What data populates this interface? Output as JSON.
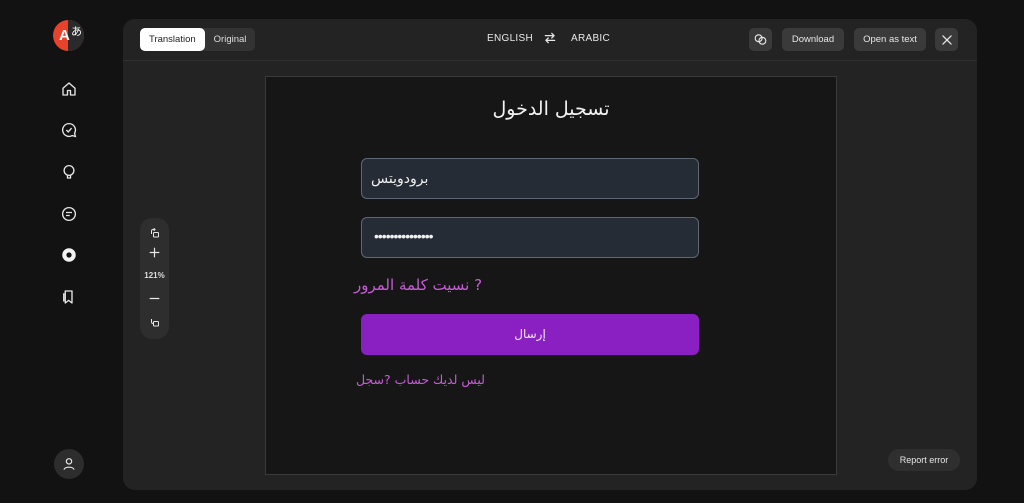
{
  "toolbar": {
    "tabs": [
      {
        "label": "Translation",
        "active": true
      },
      {
        "label": "Original",
        "active": false
      }
    ],
    "source_lang": "ENGLISH",
    "target_lang": "ARABIC",
    "download_label": "Download",
    "open_text_label": "Open as text"
  },
  "zoom": {
    "level": "121%"
  },
  "document": {
    "title": "تسجيل الدخول",
    "username_value": "برودويتس",
    "password_value": "•••••••••••••••",
    "forgot_link": "نسيت كلمة المرور ?",
    "submit_label": "إرسال",
    "register_link": "ليس لديك حساب ?سجل"
  },
  "report_error_label": "Report error",
  "colors": {
    "accent": "#8a1fc2",
    "link": "#c75bd8",
    "logo": "#e8412c"
  },
  "logo": {
    "glyph_a": "A",
    "glyph_b": "あ"
  }
}
